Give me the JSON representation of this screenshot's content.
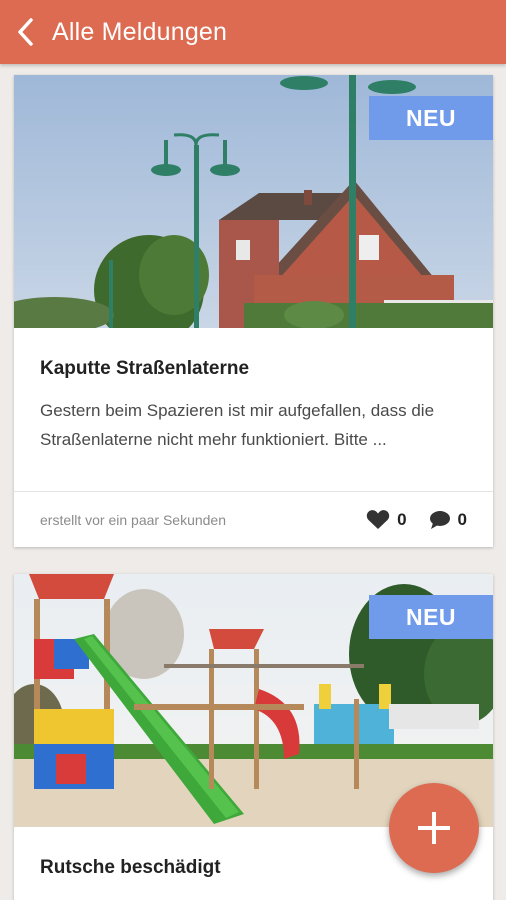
{
  "appbar": {
    "title": "Alle Meldungen",
    "back_icon": "chevron-left-icon",
    "color": "#dc6b52"
  },
  "reports": [
    {
      "badge": "NEU",
      "title": "Kaputte Straßenlaterne",
      "description": "Gestern beim Spazieren ist mir aufgefallen, dass die Straßenlaterne nicht mehr funktioniert. Bitte ...",
      "created": "erstellt vor ein paar Sekunden",
      "likes": "0",
      "comments": "0",
      "image": "street-lamp-photo"
    },
    {
      "badge": "NEU",
      "title": "Rutsche beschädigt",
      "image": "playground-photo"
    }
  ],
  "fab": {
    "icon": "plus-icon"
  },
  "colors": {
    "badge": "#6f9bea",
    "background": "#eeebe8"
  }
}
